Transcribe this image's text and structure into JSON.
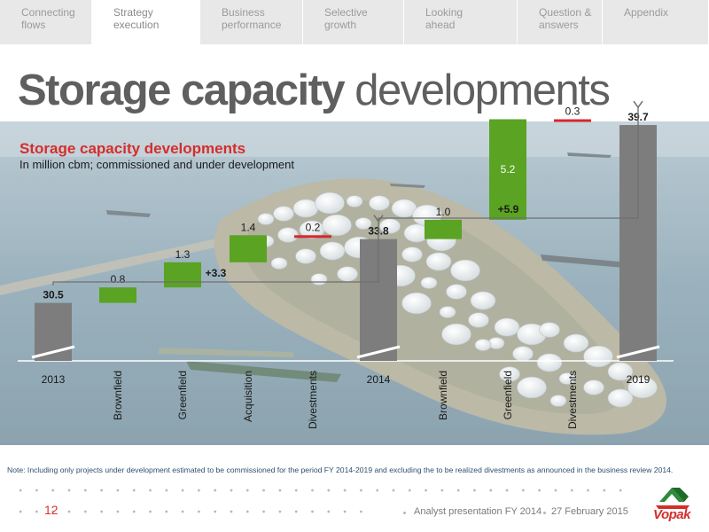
{
  "nav": {
    "tabs": [
      {
        "label": "Connecting\nflows",
        "active": false
      },
      {
        "label": "Strategy\nexecution",
        "active": true
      },
      {
        "label": "Business\nperformance",
        "active": false
      },
      {
        "label": "Selective\ngrowth",
        "active": false
      },
      {
        "label": "Looking\nahead",
        "active": false
      },
      {
        "label": "Question &\nanswers",
        "active": false
      },
      {
        "label": "Appendix",
        "active": false
      }
    ]
  },
  "headline": {
    "bold": "Storage capacity",
    "light": " developments"
  },
  "chart": {
    "title": "Storage capacity developments",
    "subtitle": "In million cbm; commissioned and under development"
  },
  "chart_data": {
    "type": "bar",
    "subtype": "waterfall",
    "unit": "million cbm",
    "categories": [
      "2013",
      "Brownfield",
      "Greenfield",
      "Acquisition",
      "Divestments",
      "2014",
      "Brownfield",
      "Greenfield",
      "Divestments",
      "2019"
    ],
    "values": [
      30.5,
      0.8,
      1.3,
      1.4,
      -0.2,
      33.8,
      1.0,
      5.2,
      -0.3,
      39.7
    ],
    "kinds": [
      "total",
      "increase",
      "increase",
      "increase",
      "decrease",
      "total",
      "increase",
      "increase",
      "decrease",
      "total"
    ],
    "value_labels": [
      "30.5",
      "0.8",
      "1.3",
      "1.4",
      "0.2",
      "33.8",
      "1.0",
      "5.2",
      "0.3",
      "39.7"
    ],
    "brackets": [
      {
        "label": "+3.3",
        "from": "2013",
        "to": "2014"
      },
      {
        "label": "+5.9",
        "from": "2014",
        "to": "2019"
      }
    ],
    "axis_break": true,
    "colors": {
      "total": "#7d7d7d",
      "increase": "#5aa323",
      "decrease": "#d8262c",
      "labels": "#1a1a1a"
    }
  },
  "footer": {
    "note": "Note: Including only projects under development estimated to be commissioned for the period FY 2014-2019 and excluding the to be realized divestments as announced in the business review 2014.",
    "page_number": "12",
    "presentation": "Analyst presentation FY 2014",
    "date": "27 February 2015",
    "logo_text": "Vopak"
  }
}
